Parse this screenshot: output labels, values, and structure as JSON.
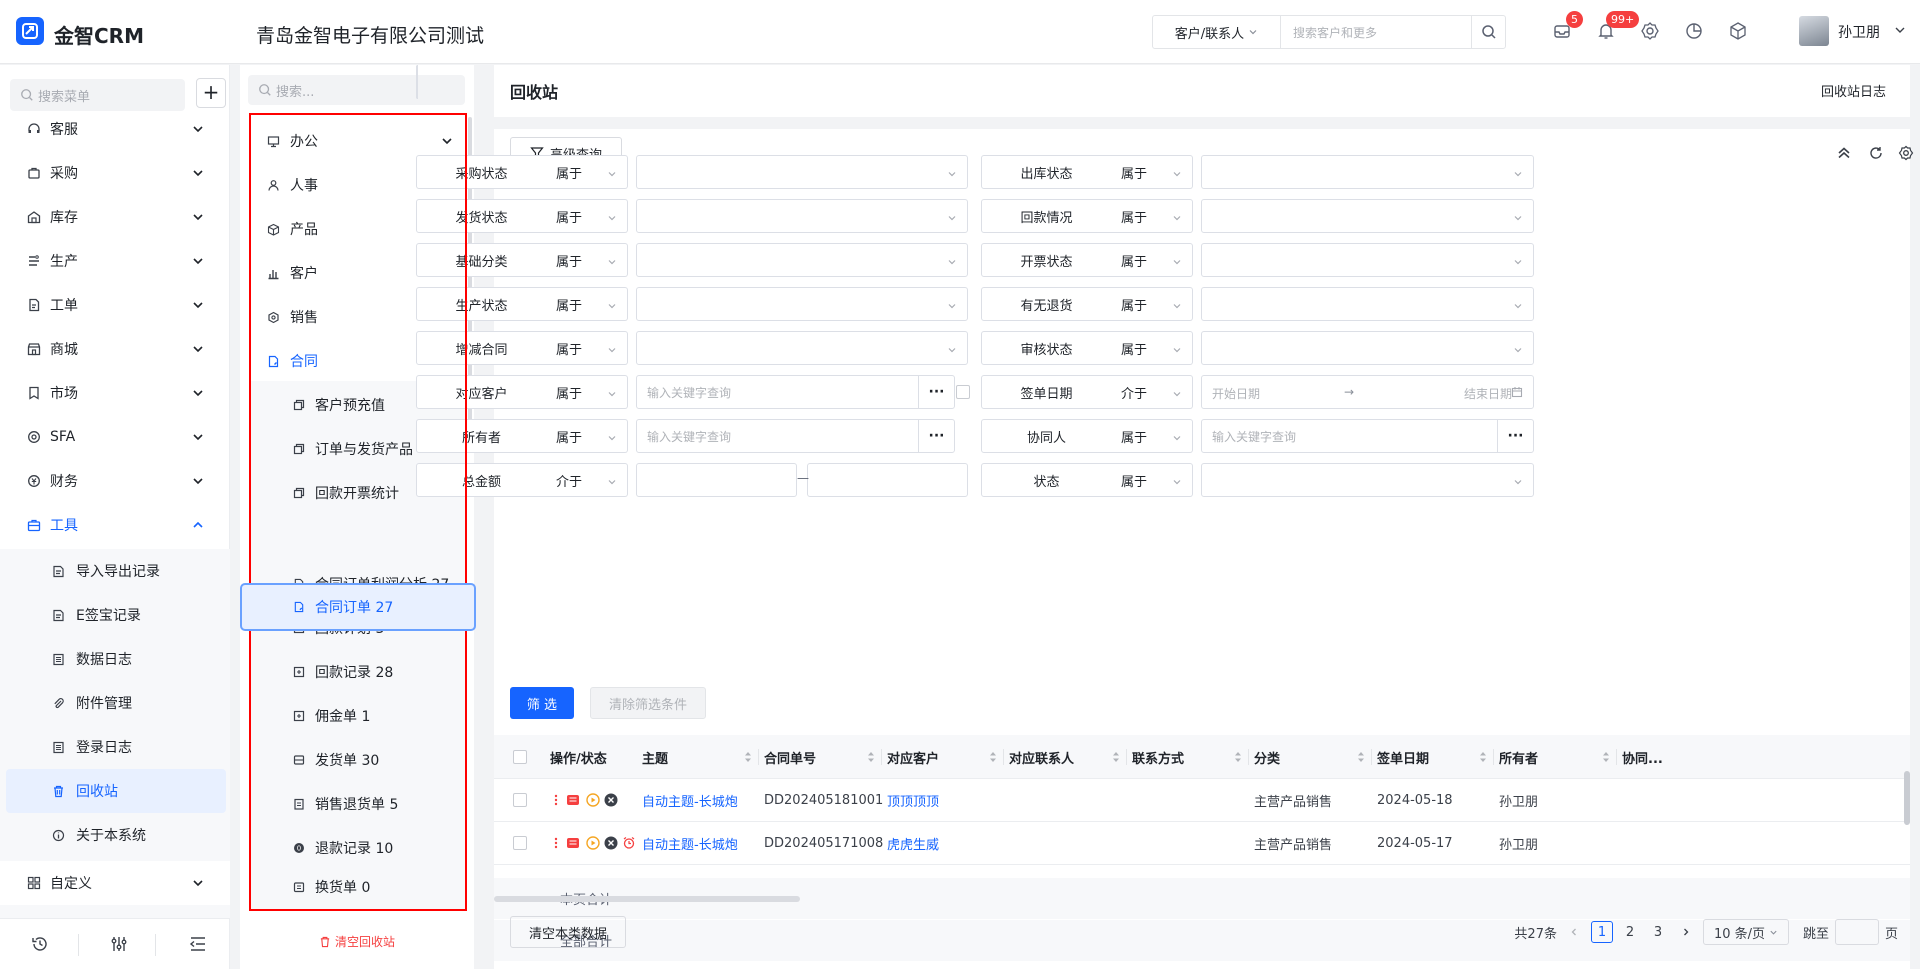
{
  "app": {
    "name": "金智CRM",
    "company": "青岛金智电子有限公司测试"
  },
  "topbar": {
    "search_type": "客户/联系人",
    "search_placeholder": "搜索客户和更多",
    "mail_badge": "5",
    "notify_badge": "99+",
    "username": "孙卫朋"
  },
  "leftnav": {
    "search_placeholder": "搜索菜单",
    "add_label": "+",
    "items": [
      {
        "label": "客服",
        "icon": "headset-icon"
      },
      {
        "label": "采购",
        "icon": "cart-icon"
      },
      {
        "label": "库存",
        "icon": "warehouse-icon"
      },
      {
        "label": "生产",
        "icon": "factory-icon"
      },
      {
        "label": "工单",
        "icon": "ticket-icon"
      },
      {
        "label": "商城",
        "icon": "store-icon"
      },
      {
        "label": "市场",
        "icon": "flag-icon"
      },
      {
        "label": "SFA",
        "icon": "sfa-icon"
      },
      {
        "label": "财务",
        "icon": "finance-icon"
      },
      {
        "label": "工具",
        "icon": "toolbox-icon"
      }
    ],
    "tools_sub": [
      {
        "label": "导入导出记录",
        "icon": "import-export-icon"
      },
      {
        "label": "E签宝记录",
        "icon": "esign-icon"
      },
      {
        "label": "数据日志",
        "icon": "data-log-icon"
      },
      {
        "label": "附件管理",
        "icon": "attachment-icon"
      },
      {
        "label": "登录日志",
        "icon": "login-log-icon"
      },
      {
        "label": "回收站",
        "icon": "trash-icon"
      },
      {
        "label": "关于本系统",
        "icon": "info-icon"
      }
    ],
    "custom": {
      "label": "自定义",
      "icon": "grid-icon"
    }
  },
  "panel2": {
    "search_placeholder": "搜索...",
    "items": [
      {
        "label": "办公",
        "icon": "office-icon"
      },
      {
        "label": "人事",
        "icon": "people-icon"
      },
      {
        "label": "产品",
        "icon": "cube-icon"
      },
      {
        "label": "客户",
        "icon": "chart-icon"
      },
      {
        "label": "销售",
        "icon": "hexagon-icon"
      },
      {
        "label": "合同",
        "icon": "contract-icon"
      }
    ],
    "contract_sub": [
      {
        "label": "客户预充值",
        "icon": "copy-icon"
      },
      {
        "label": "订单与发货产品",
        "icon": "copy-icon"
      },
      {
        "label": "回款开票统计",
        "icon": "copy-icon"
      },
      {
        "label": "合同订单 27",
        "icon": "contract-icon"
      },
      {
        "label": "合同订单利润分析 27",
        "icon": "contract-icon"
      },
      {
        "label": "回款计划 3",
        "icon": "plan-icon"
      },
      {
        "label": "回款记录 28",
        "icon": "plan-icon"
      },
      {
        "label": "佣金单 1",
        "icon": "plan-icon"
      },
      {
        "label": "发货单 30",
        "icon": "truck-icon"
      },
      {
        "label": "销售退货单 5",
        "icon": "return-icon"
      },
      {
        "label": "退款记录 10",
        "icon": "refund-icon"
      },
      {
        "label": "换货单 0",
        "icon": "exchange-icon"
      }
    ],
    "empty_bin": "清空回收站"
  },
  "main": {
    "title": "回收站",
    "log_link": "回收站日志",
    "adv_query": "高级查询",
    "filters": [
      {
        "label": "采购状态",
        "op": "属于",
        "value": ""
      },
      {
        "label": "出库状态",
        "op": "属于",
        "value": ""
      },
      {
        "label": "发货状态",
        "op": "属于",
        "value": ""
      },
      {
        "label": "回款情况",
        "op": "属于",
        "value": ""
      },
      {
        "label": "基础分类",
        "op": "属于",
        "value": ""
      },
      {
        "label": "开票状态",
        "op": "属于",
        "value": ""
      },
      {
        "label": "生产状态",
        "op": "属于",
        "value": ""
      },
      {
        "label": "有无退货",
        "op": "属于",
        "value": ""
      },
      {
        "label": "增减合同",
        "op": "属于",
        "value": ""
      },
      {
        "label": "审核状态",
        "op": "属于",
        "value": ""
      },
      {
        "label": "对应客户",
        "op": "属于",
        "value": "输入关键字查询"
      },
      {
        "label": "签单日期",
        "op": "介于",
        "value": ""
      },
      {
        "label": "所有者",
        "op": "属于",
        "value": "输入关键字查询"
      },
      {
        "label": "协同人",
        "op": "属于",
        "value": "输入关键字查询"
      },
      {
        "label": "总金额",
        "op": "介于",
        "value": ""
      },
      {
        "label": "状态",
        "op": "属于",
        "value": ""
      }
    ],
    "date_start": "开始日期",
    "date_arrow": "→",
    "date_end": "结束日期",
    "range_sep": "—",
    "filter_btn": "筛 选",
    "clear_btn": "清除筛选条件",
    "columns": [
      "操作/状态",
      "主题",
      "合同单号",
      "对应客户",
      "对应联系人",
      "联系方式",
      "分类",
      "签单日期",
      "所有者",
      "协同..."
    ],
    "rows": [
      {
        "subject": "自动主题-长城炮",
        "no": "DD202405181001",
        "customer": "顶顶顶顶",
        "contact": "",
        "phone": "",
        "category": "主营产品销售",
        "date": "2024-05-18",
        "owner": "孙卫朋"
      },
      {
        "subject": "自动主题-长城炮",
        "no": "DD202405171008",
        "customer": "虎虎生威",
        "contact": "",
        "phone": "",
        "category": "主营产品销售",
        "date": "2024-05-17",
        "owner": "孙卫朋"
      }
    ],
    "page_total": "本页合计",
    "all_total": "全部合计",
    "bulk_clear": "清空本类数据",
    "pager": {
      "total": "共27条",
      "pages": [
        "1",
        "2",
        "3"
      ],
      "current": "1",
      "page_size": "10 条/页",
      "jump_label": "跳至",
      "page_unit": "页"
    }
  },
  "colors": {
    "primary": "#1664ff",
    "danger": "#f53f3f",
    "highlight_box": "#ff0000"
  }
}
